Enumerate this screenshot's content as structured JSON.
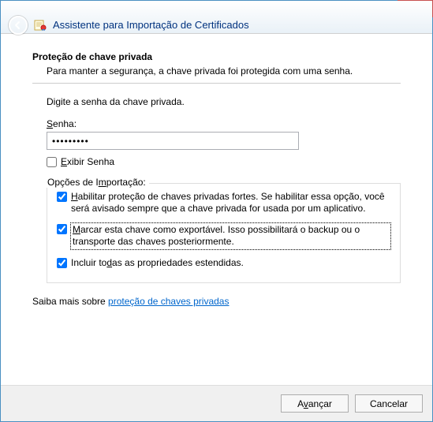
{
  "titlebar": {
    "close_label": "✕"
  },
  "header": {
    "title": "Assistente para Importação de Certificados"
  },
  "section": {
    "title": "Proteção de chave privada",
    "description": "Para manter a segurança, a chave privada foi protegida com uma senha.",
    "prompt": "Digite a senha da chave privada."
  },
  "password": {
    "label_pre": "S",
    "label_post": "enha:",
    "value": "•••••••••",
    "show_pre": "E",
    "show_post": "xibir Senha",
    "show_checked": false
  },
  "options": {
    "legend_pre": "Opções de I",
    "legend_u": "m",
    "legend_post": "portação:",
    "opt1_pre": "H",
    "opt1_post": "abilitar proteção de chaves privadas fortes. Se habilitar essa opção, você será avisado sempre que a chave privada for usada por um aplicativo.",
    "opt1_checked": true,
    "opt2_pre": "M",
    "opt2_post": "arcar esta chave como exportável. Isso possibilitará o backup ou o transporte das chaves posteriormente.",
    "opt2_checked": true,
    "opt3_pre": "Incluir to",
    "opt3_u": "d",
    "opt3_post": "as as propriedades estendidas.",
    "opt3_checked": true
  },
  "more": {
    "text": "Saiba mais sobre ",
    "link": "proteção de chaves privadas"
  },
  "footer": {
    "next_pre": "A",
    "next_u": "v",
    "next_post": "ançar",
    "cancel": "Cancelar"
  }
}
